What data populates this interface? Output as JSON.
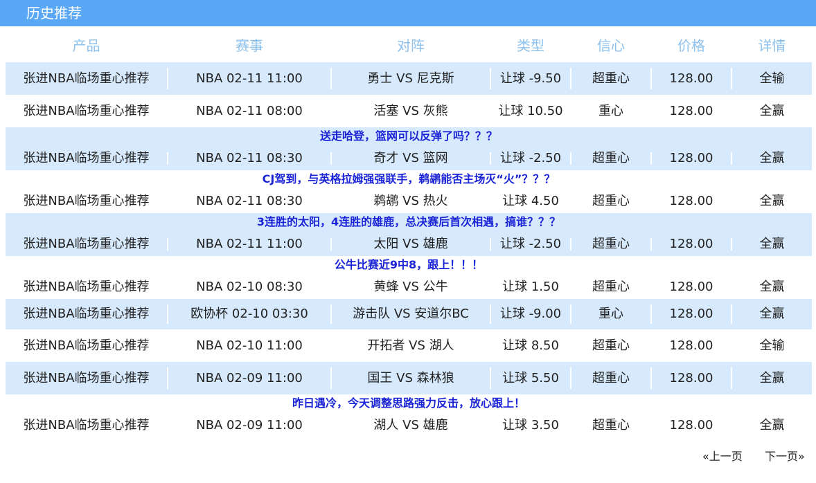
{
  "header": {
    "title": "历史推荐"
  },
  "columns": [
    "产品",
    "赛事",
    "对阵",
    "类型",
    "信心",
    "价格",
    "详情"
  ],
  "rows": [
    {
      "product": "张进NBA临场重心推荐",
      "event": "NBA 02-11 11:00",
      "match": "勇士 VS 尼克斯",
      "type": "让球 -9.50",
      "confidence": "超重心",
      "price": "128.00",
      "detail": "全输",
      "note": ""
    },
    {
      "product": "张进NBA临场重心推荐",
      "event": "NBA 02-11 08:00",
      "match": "活塞 VS 灰熊",
      "type": "让球 10.50",
      "confidence": "重心",
      "price": "128.00",
      "detail": "全赢",
      "note": ""
    },
    {
      "product": "张进NBA临场重心推荐",
      "event": "NBA 02-11 08:30",
      "match": "奇才 VS 篮网",
      "type": "让球 -2.50",
      "confidence": "超重心",
      "price": "128.00",
      "detail": "全赢",
      "note": "送走哈登，篮网可以反弹了吗？？？"
    },
    {
      "product": "张进NBA临场重心推荐",
      "event": "NBA 02-11 08:30",
      "match": "鹈鹕 VS 热火",
      "type": "让球 4.50",
      "confidence": "超重心",
      "price": "128.00",
      "detail": "全赢",
      "note": "CJ驾到，与英格拉姆强强联手，鹈鹕能否主场灭“火”？？？"
    },
    {
      "product": "张进NBA临场重心推荐",
      "event": "NBA 02-11 11:00",
      "match": "太阳 VS 雄鹿",
      "type": "让球 -2.50",
      "confidence": "超重心",
      "price": "128.00",
      "detail": "全赢",
      "note": "3连胜的太阳，4连胜的雄鹿，总决赛后首次相遇，搞谁？？？"
    },
    {
      "product": "张进NBA临场重心推荐",
      "event": "NBA 02-10 08:30",
      "match": "黄蜂 VS 公牛",
      "type": "让球 1.50",
      "confidence": "超重心",
      "price": "128.00",
      "detail": "全赢",
      "note": "公牛比赛近9中8，跟上！！！"
    },
    {
      "product": "张进NBA临场重心推荐",
      "event": "欧协杯 02-10 03:30",
      "match": "游击队 VS 安道尔BC",
      "type": "让球 -9.00",
      "confidence": "重心",
      "price": "128.00",
      "detail": "全赢",
      "note": ""
    },
    {
      "product": "张进NBA临场重心推荐",
      "event": "NBA 02-10 11:00",
      "match": "开拓者 VS 湖人",
      "type": "让球 8.50",
      "confidence": "超重心",
      "price": "128.00",
      "detail": "全输",
      "note": ""
    },
    {
      "product": "张进NBA临场重心推荐",
      "event": "NBA 02-09 11:00",
      "match": "国王 VS 森林狼",
      "type": "让球 5.50",
      "confidence": "超重心",
      "price": "128.00",
      "detail": "全赢",
      "note": ""
    },
    {
      "product": "张进NBA临场重心推荐",
      "event": "NBA 02-09 11:00",
      "match": "湖人 VS 雄鹿",
      "type": "让球 3.50",
      "confidence": "超重心",
      "price": "128.00",
      "detail": "全赢",
      "note": "昨日遇冷，今天调整思路强力反击，放心跟上！"
    }
  ],
  "pagination": {
    "prev": "«上一页",
    "next": "下一页»"
  }
}
